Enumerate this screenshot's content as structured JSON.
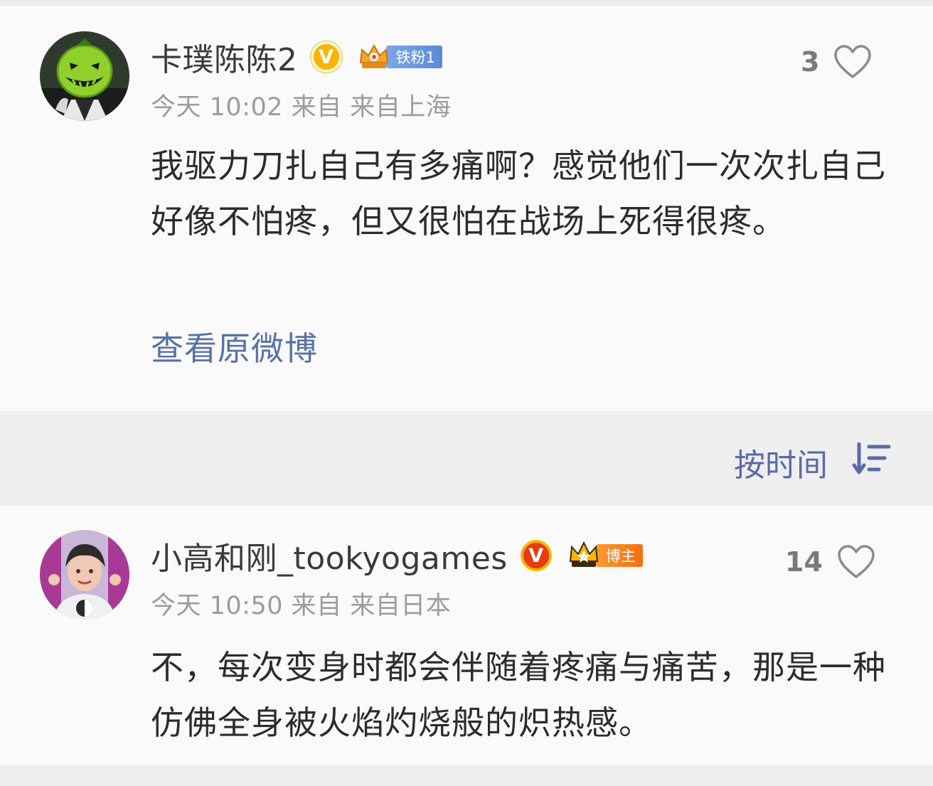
{
  "comments": [
    {
      "username": "卡璞陈陈2",
      "verify_mark": "V",
      "verify_color": "#f7b500",
      "badge_icon": "crown-badge-icon",
      "badge_label": "铁粉1",
      "badge_color": "#6a98e0",
      "meta": "今天 10:02 来自 来自上海",
      "likes": "3",
      "text": "我驱力刀扎自己有多痛啊？感觉他们一次次扎自己好像不怕疼，但又很怕在战场上死得很疼。",
      "view_original": "查看原微博"
    },
    {
      "username": "小高和刚_tookyogames",
      "verify_mark": "V",
      "verify_color": "#e93a12",
      "badge_icon": "crown-badge-icon",
      "badge_label": "博主",
      "badge_color": "#f47a1a",
      "meta": "今天 10:50 来自 来自日本",
      "likes": "14",
      "text": "不，每次变身时都会伴随着疼痛与痛苦，那是一种仿佛全身被火焰灼烧般的炽热感。"
    }
  ],
  "sort": {
    "label": "按时间",
    "icon": "sort-order-icon"
  },
  "colors": {
    "link": "#5872a8",
    "sort_text": "#5a6aa8",
    "meta_text": "#9c9c9c",
    "divider": "#efefef"
  }
}
